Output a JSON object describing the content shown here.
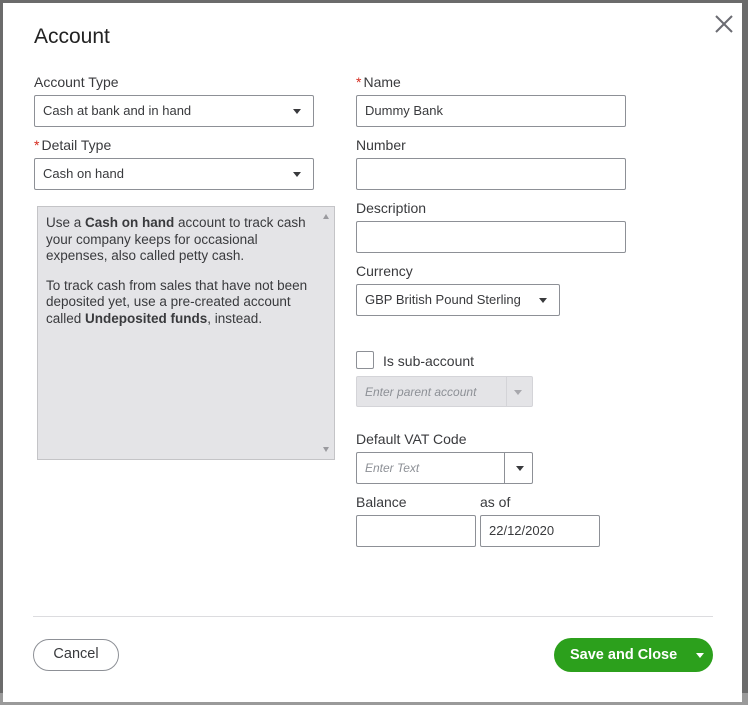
{
  "dialog": {
    "title": "Account",
    "close_icon": "close-icon"
  },
  "form": {
    "account_type": {
      "label": "Account Type",
      "value": "Cash at bank and in hand"
    },
    "detail_type": {
      "required_mark": "*",
      "label": "Detail Type",
      "value": "Cash on hand"
    },
    "name": {
      "required_mark": "*",
      "label": "Name",
      "value": "Dummy Bank"
    },
    "number": {
      "label": "Number",
      "value": ""
    },
    "description": {
      "label": "Description",
      "value": ""
    },
    "currency": {
      "label": "Currency",
      "value": "GBP British Pound Sterling"
    },
    "sub_account": {
      "label": "Is sub-account",
      "checked": false,
      "parent_placeholder": "Enter parent account"
    },
    "vat_code": {
      "label": "Default VAT Code",
      "placeholder": "Enter Text"
    },
    "balance": {
      "label": "Balance",
      "value": ""
    },
    "as_of": {
      "label": "as of",
      "value": "22/12/2020"
    }
  },
  "detail_description": {
    "p1_a": "Use a ",
    "p1_b": "Cash on hand",
    "p1_c": " account to track cash your company keeps for occasional expenses, also called petty cash.",
    "p2_a": "To track cash from sales that have not been deposited yet, use a pre-created account called ",
    "p2_b": "Undeposited funds",
    "p2_c": ", instead."
  },
  "footer": {
    "cancel_label": "Cancel",
    "save_label": "Save and Close"
  },
  "colors": {
    "primary_green": "#2ca01c",
    "required_red": "#d52b1e"
  }
}
